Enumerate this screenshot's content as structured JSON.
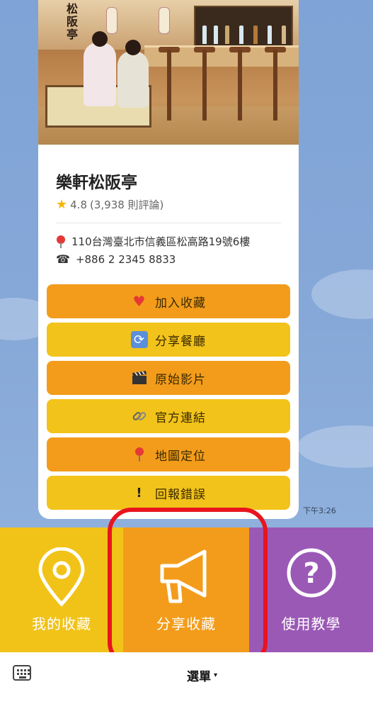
{
  "restaurant": {
    "name": "樂軒松阪亭",
    "rating": "4.8",
    "reviews": "(3,938 則評論)",
    "address": "110台灣臺北市信義區松高路19號6樓",
    "phone": "+886 2 2345 8833",
    "sign_text": "松阪亭"
  },
  "actions": [
    {
      "label": "加入收藏",
      "icon": "heart-icon",
      "color": "#f39c1b"
    },
    {
      "label": "分享餐廳",
      "icon": "repeat-icon",
      "color": "#f2c31a"
    },
    {
      "label": "原始影片",
      "icon": "clapper-icon",
      "color": "#f39c1b"
    },
    {
      "label": "官方連結",
      "icon": "link-icon",
      "color": "#f2c31a"
    },
    {
      "label": "地圖定位",
      "icon": "pushpin-icon",
      "color": "#f39c1b"
    },
    {
      "label": "回報錯誤",
      "icon": "exclamation-icon",
      "color": "#f2c31a"
    }
  ],
  "timestamp": "下午3:26",
  "rich_menu": {
    "left": {
      "label": "我的收藏",
      "icon": "location-pin-icon",
      "color": "#f1c318"
    },
    "middle": {
      "label": "分享收藏",
      "icon": "megaphone-icon",
      "color": "#f39c1b"
    },
    "right": {
      "label": "使用教學",
      "icon": "question-icon",
      "color": "#9b59b6"
    }
  },
  "bottom_bar": {
    "menu_label": "選單",
    "caret": "▾"
  },
  "highlight_color": "#e8141e"
}
